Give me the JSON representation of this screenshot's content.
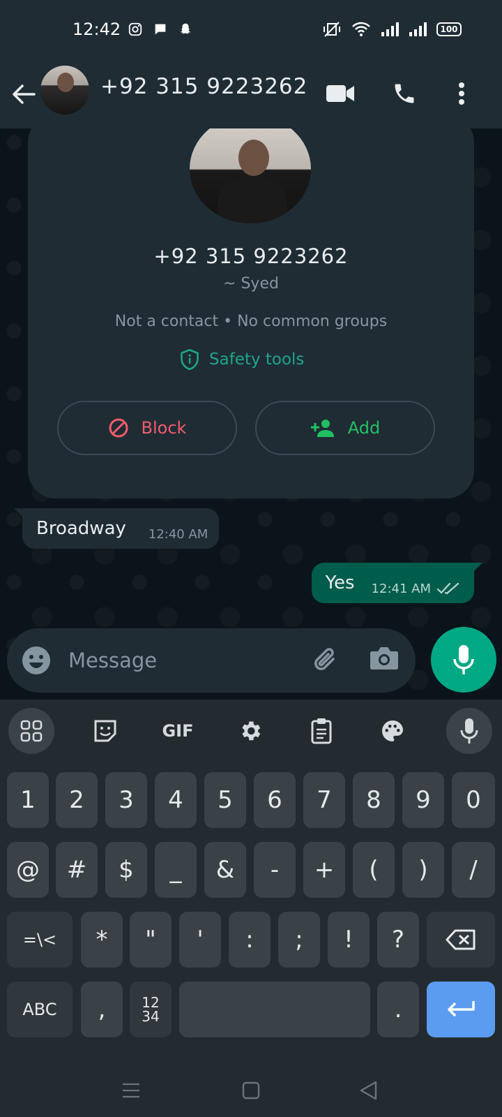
{
  "status": {
    "time": "12:42",
    "battery": "100"
  },
  "appbar": {
    "contact_name": "+92 315 9223262"
  },
  "info_card": {
    "number": "+92 315 9223262",
    "alias": "~ Syed",
    "meta": "Not a contact • No common groups",
    "safety_label": "Safety tools",
    "block_label": "Block",
    "add_label": "Add"
  },
  "messages": [
    {
      "text": "Broadway",
      "time": "12:40 AM",
      "direction": "incoming"
    },
    {
      "text": "Yes",
      "time": "12:41 AM",
      "direction": "outgoing"
    }
  ],
  "composer": {
    "placeholder": "Message"
  },
  "keyboard": {
    "toolbar": [
      "apps-grid",
      "sticker",
      "GIF",
      "settings",
      "clipboard",
      "theme",
      "mic"
    ],
    "gif_label": "GIF",
    "row1": [
      "1",
      "2",
      "3",
      "4",
      "5",
      "6",
      "7",
      "8",
      "9",
      "0"
    ],
    "row2": [
      "@",
      "#",
      "$",
      "_",
      "&",
      "-",
      "+",
      "(",
      ")",
      "/"
    ],
    "row3": [
      "=\\<",
      "*",
      "\"",
      "'",
      ":",
      ";",
      "!",
      "?"
    ],
    "row4": {
      "abc": "ABC",
      "comma": ",",
      "num_top": "12",
      "num_bottom": "34",
      "period": "."
    }
  },
  "colors": {
    "accent": "#00a884",
    "bubble_out": "#005c4b",
    "bubble_in": "#1f2c34",
    "block_red": "#f15c6d",
    "enter_blue": "#5b9cf0"
  }
}
